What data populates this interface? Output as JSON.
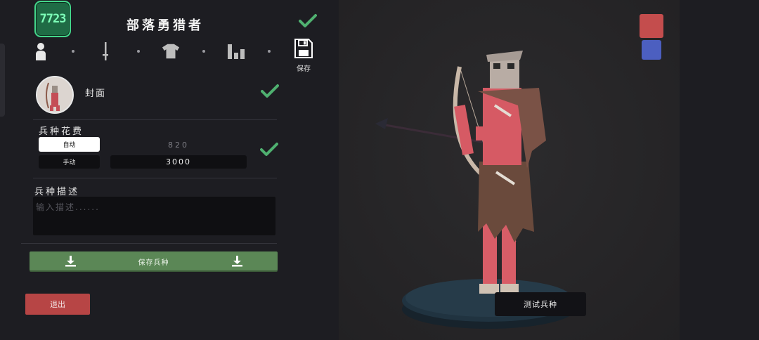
{
  "header": {
    "money": "7723",
    "unit_name": "部落勇猎者"
  },
  "tabs": [
    {
      "icon": "person-icon"
    },
    {
      "icon": "sword-icon"
    },
    {
      "icon": "shirt-icon"
    },
    {
      "icon": "bar-chart-icon"
    },
    {
      "icon": "floppy-disk-icon",
      "label": "保存"
    }
  ],
  "cover": {
    "label": "封面"
  },
  "cost": {
    "title": "兵种花费",
    "auto_label": "自动",
    "manual_label": "手动",
    "auto_value": "820",
    "manual_value": "3000"
  },
  "description": {
    "title": "兵种描述",
    "placeholder": "输入描述......"
  },
  "actions": {
    "save_unit": "保存兵种",
    "exit": "退出",
    "test_unit": "测试兵种"
  },
  "colors": {
    "accent_green": "#5b8756",
    "check_green": "#4fb070",
    "team_red": "#c44d4d",
    "team_blue": "#4c5fc0",
    "exit_red": "#b74545"
  }
}
